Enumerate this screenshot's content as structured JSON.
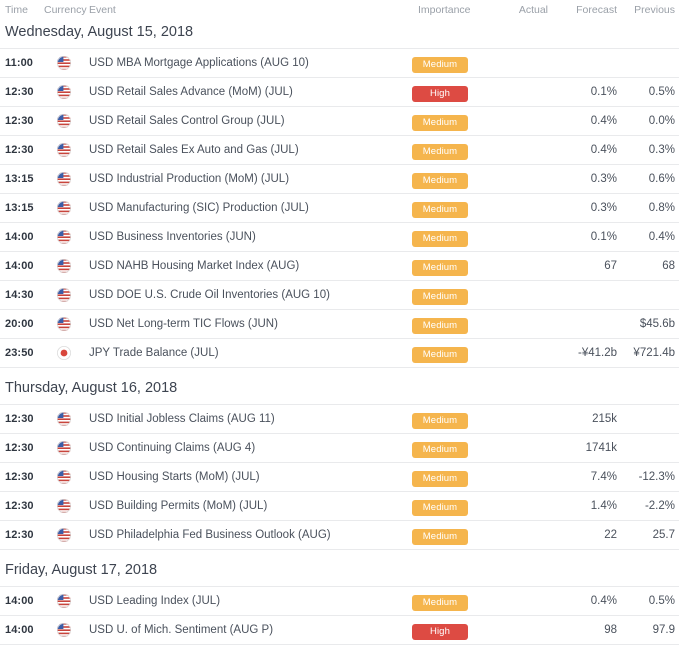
{
  "columns": {
    "time": "Time",
    "currency": "Currency",
    "event": "Event",
    "importance": "Importance",
    "actual": "Actual",
    "forecast": "Forecast",
    "previous": "Previous"
  },
  "colors": {
    "medium_badge": "#f5b54d",
    "high_badge": "#dd4b43",
    "row_border": "#e9eaec",
    "header_text": "#9aa0a8",
    "body_text": "#4a515c",
    "time_text": "#2f3640",
    "background": "#ffffff"
  },
  "importance_labels": {
    "medium": "Medium",
    "high": "High"
  },
  "days": [
    {
      "heading": "Wednesday, August 15, 2018",
      "events": [
        {
          "time": "11:00",
          "flag": "us-flag-icon",
          "currency": "USD",
          "event": "MBA Mortgage Applications (AUG 10)",
          "event_full": "USD MBA Mortgage Applications (AUG 10)",
          "importance": "Medium",
          "importance_key": "medium",
          "actual": "",
          "forecast": "",
          "previous": ""
        },
        {
          "time": "12:30",
          "flag": "us-flag-icon",
          "currency": "USD",
          "event": "Retail Sales Advance (MoM) (JUL)",
          "event_full": "USD Retail Sales Advance (MoM) (JUL)",
          "importance": "High",
          "importance_key": "high",
          "actual": "",
          "forecast": "0.1%",
          "previous": "0.5%"
        },
        {
          "time": "12:30",
          "flag": "us-flag-icon",
          "currency": "USD",
          "event": "Retail Sales Control Group (JUL)",
          "event_full": "USD Retail Sales Control Group (JUL)",
          "importance": "Medium",
          "importance_key": "medium",
          "actual": "",
          "forecast": "0.4%",
          "previous": "0.0%"
        },
        {
          "time": "12:30",
          "flag": "us-flag-icon",
          "currency": "USD",
          "event": "Retail Sales Ex Auto and Gas (JUL)",
          "event_full": "USD Retail Sales Ex Auto and Gas (JUL)",
          "importance": "Medium",
          "importance_key": "medium",
          "actual": "",
          "forecast": "0.4%",
          "previous": "0.3%"
        },
        {
          "time": "13:15",
          "flag": "us-flag-icon",
          "currency": "USD",
          "event": "Industrial Production (MoM) (JUL)",
          "event_full": "USD Industrial Production (MoM) (JUL)",
          "importance": "Medium",
          "importance_key": "medium",
          "actual": "",
          "forecast": "0.3%",
          "previous": "0.6%"
        },
        {
          "time": "13:15",
          "flag": "us-flag-icon",
          "currency": "USD",
          "event": "Manufacturing (SIC) Production (JUL)",
          "event_full": "USD Manufacturing (SIC) Production (JUL)",
          "importance": "Medium",
          "importance_key": "medium",
          "actual": "",
          "forecast": "0.3%",
          "previous": "0.8%"
        },
        {
          "time": "14:00",
          "flag": "us-flag-icon",
          "currency": "USD",
          "event": "Business Inventories (JUN)",
          "event_full": "USD Business Inventories (JUN)",
          "importance": "Medium",
          "importance_key": "medium",
          "actual": "",
          "forecast": "0.1%",
          "previous": "0.4%"
        },
        {
          "time": "14:00",
          "flag": "us-flag-icon",
          "currency": "USD",
          "event": "NAHB Housing Market Index (AUG)",
          "event_full": "USD NAHB Housing Market Index (AUG)",
          "importance": "Medium",
          "importance_key": "medium",
          "actual": "",
          "forecast": "67",
          "previous": "68"
        },
        {
          "time": "14:30",
          "flag": "us-flag-icon",
          "currency": "USD",
          "event": "DOE U.S. Crude Oil Inventories (AUG 10)",
          "event_full": "USD DOE U.S. Crude Oil Inventories (AUG 10)",
          "importance": "Medium",
          "importance_key": "medium",
          "actual": "",
          "forecast": "",
          "previous": ""
        },
        {
          "time": "20:00",
          "flag": "us-flag-icon",
          "currency": "USD",
          "event": "Net Long-term TIC Flows (JUN)",
          "event_full": "USD Net Long-term TIC Flows (JUN)",
          "importance": "Medium",
          "importance_key": "medium",
          "actual": "",
          "forecast": "",
          "previous": "$45.6b"
        },
        {
          "time": "23:50",
          "flag": "jp-flag-icon",
          "currency": "JPY",
          "event": "Trade Balance (JUL)",
          "event_full": "JPY Trade Balance (JUL)",
          "importance": "Medium",
          "importance_key": "medium",
          "actual": "",
          "forecast": "-¥41.2b",
          "previous": "¥721.4b"
        }
      ]
    },
    {
      "heading": "Thursday, August 16, 2018",
      "events": [
        {
          "time": "12:30",
          "flag": "us-flag-icon",
          "currency": "USD",
          "event": "Initial Jobless Claims (AUG 11)",
          "event_full": "USD Initial Jobless Claims (AUG 11)",
          "importance": "Medium",
          "importance_key": "medium",
          "actual": "",
          "forecast": "215k",
          "previous": ""
        },
        {
          "time": "12:30",
          "flag": "us-flag-icon",
          "currency": "USD",
          "event": "Continuing Claims (AUG 4)",
          "event_full": "USD Continuing Claims (AUG 4)",
          "importance": "Medium",
          "importance_key": "medium",
          "actual": "",
          "forecast": "1741k",
          "previous": ""
        },
        {
          "time": "12:30",
          "flag": "us-flag-icon",
          "currency": "USD",
          "event": "Housing Starts (MoM) (JUL)",
          "event_full": "USD Housing Starts (MoM) (JUL)",
          "importance": "Medium",
          "importance_key": "medium",
          "actual": "",
          "forecast": "7.4%",
          "previous": "-12.3%"
        },
        {
          "time": "12:30",
          "flag": "us-flag-icon",
          "currency": "USD",
          "event": "Building Permits (MoM) (JUL)",
          "event_full": "USD Building Permits (MoM) (JUL)",
          "importance": "Medium",
          "importance_key": "medium",
          "actual": "",
          "forecast": "1.4%",
          "previous": "-2.2%"
        },
        {
          "time": "12:30",
          "flag": "us-flag-icon",
          "currency": "USD",
          "event": "Philadelphia Fed Business Outlook (AUG)",
          "event_full": "USD Philadelphia Fed Business Outlook (AUG)",
          "importance": "Medium",
          "importance_key": "medium",
          "actual": "",
          "forecast": "22",
          "previous": "25.7"
        }
      ]
    },
    {
      "heading": "Friday, August 17, 2018",
      "events": [
        {
          "time": "14:00",
          "flag": "us-flag-icon",
          "currency": "USD",
          "event": "Leading Index (JUL)",
          "event_full": "USD Leading Index (JUL)",
          "importance": "Medium",
          "importance_key": "medium",
          "actual": "",
          "forecast": "0.4%",
          "previous": "0.5%"
        },
        {
          "time": "14:00",
          "flag": "us-flag-icon",
          "currency": "USD",
          "event": "U. of Mich. Sentiment (AUG P)",
          "event_full": "USD U. of Mich. Sentiment (AUG P)",
          "importance": "High",
          "importance_key": "high",
          "actual": "",
          "forecast": "98",
          "previous": "97.9"
        }
      ]
    }
  ]
}
